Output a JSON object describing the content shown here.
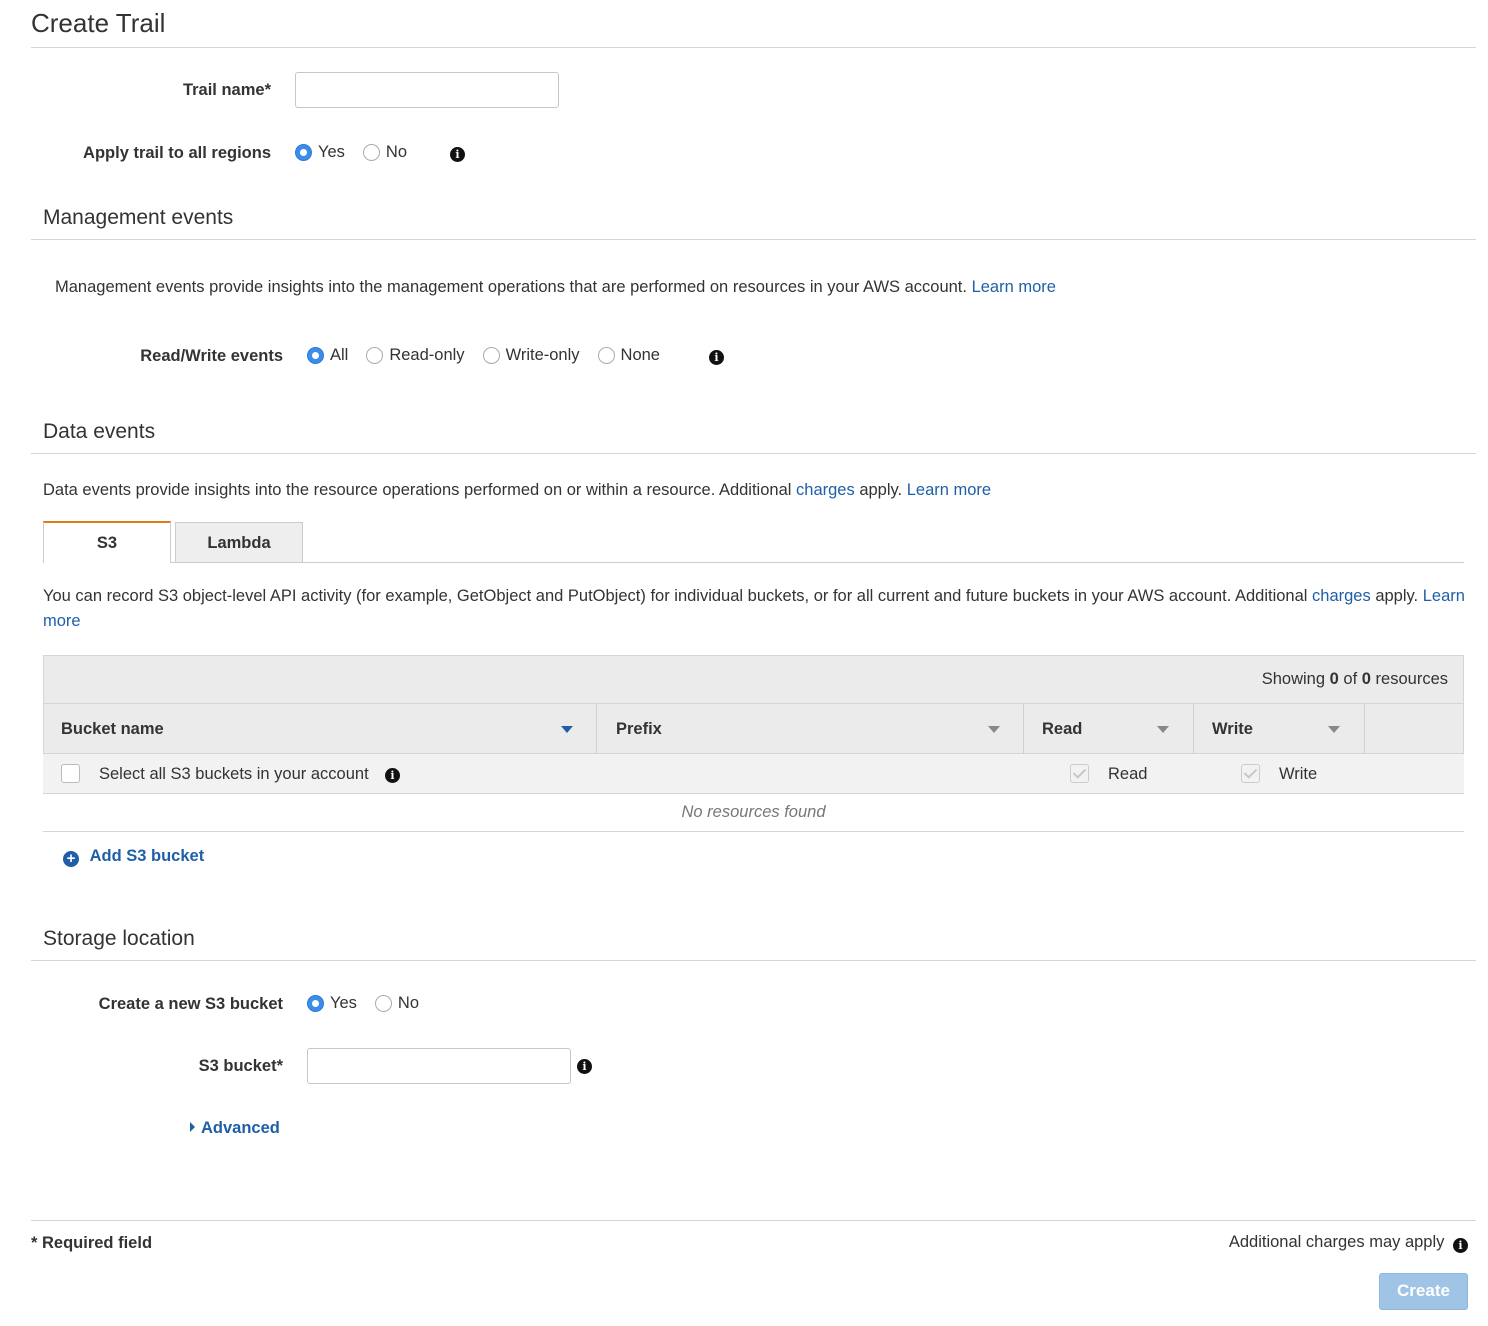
{
  "page": {
    "title": "Create Trail"
  },
  "trail": {
    "name_label": "Trail name*",
    "name_value": "",
    "regions_label": "Apply trail to all regions",
    "regions_options": [
      "Yes",
      "No"
    ],
    "regions_selected": "Yes"
  },
  "management": {
    "heading": "Management events",
    "description": "Management events provide insights into the management operations that are performed on resources in your AWS account.",
    "learn_more": "Learn more",
    "rw_label": "Read/Write events",
    "rw_options": [
      "All",
      "Read-only",
      "Write-only",
      "None"
    ],
    "rw_selected": "All"
  },
  "data_events": {
    "heading": "Data events",
    "desc_pre": "Data events provide insights into the resource operations performed on or within a resource. Additional",
    "charges": "charges",
    "desc_post": "apply.",
    "learn_more": "Learn more",
    "tabs": [
      "S3",
      "Lambda"
    ],
    "active_tab": "S3",
    "s3_desc_pre": "You can record S3 object-level API activity (for example, GetObject and PutObject) for individual buckets, or for all current and future buckets in your AWS account. Additional",
    "s3_charges": "charges",
    "s3_desc_post": "apply.",
    "s3_learn_more": "Learn more",
    "table": {
      "showing_pre": "Showing",
      "showing_count": "0",
      "showing_of": "of",
      "showing_total": "0",
      "showing_post": "resources",
      "columns": [
        "Bucket name",
        "Prefix",
        "Read",
        "Write"
      ],
      "select_all_label": "Select all S3 buckets in your account",
      "read_label": "Read",
      "write_label": "Write",
      "empty_text": "No resources found"
    },
    "add_bucket": "Add S3 bucket"
  },
  "storage": {
    "heading": "Storage location",
    "create_label": "Create a new S3 bucket",
    "create_options": [
      "Yes",
      "No"
    ],
    "create_selected": "Yes",
    "bucket_label": "S3 bucket*",
    "bucket_value": "",
    "advanced": "Advanced"
  },
  "footer": {
    "required": "* Required field",
    "charges_note": "Additional charges may apply",
    "create_button": "Create"
  },
  "colors": {
    "link": "#1f5fa8",
    "radio_on": "#3b8de9",
    "tab_accent": "#e07b1a",
    "create_disabled": "#9fc4e6"
  },
  "icons": [
    "info-icon",
    "plus-circle-icon",
    "caret-right-icon",
    "sort-caret-icon"
  ]
}
